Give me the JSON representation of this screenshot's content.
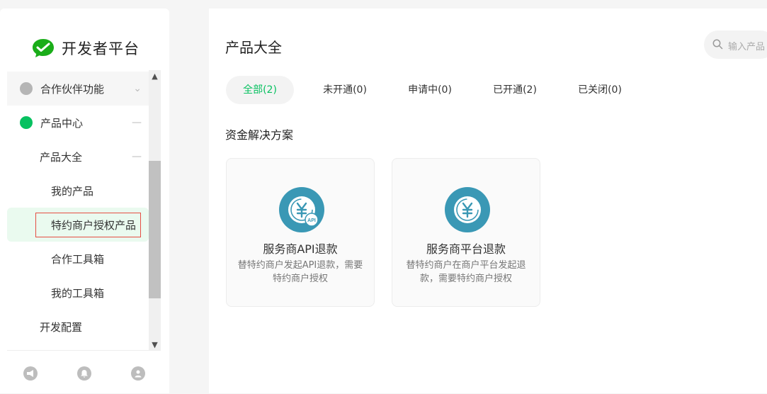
{
  "sidebar": {
    "logo": {
      "title": "开发者平台",
      "icon": "wechat-pay-icon",
      "color": "#1aad19"
    },
    "items": [
      {
        "label": "合作伙伴功能",
        "toggle": "⌄",
        "dot_color": "#b5b5b5"
      },
      {
        "label": "产品中心",
        "toggle": "—",
        "dot_color": "#07c160"
      },
      {
        "label": "产品大全",
        "toggle": "—"
      },
      {
        "label": "我的产品"
      },
      {
        "label": "特约商户授权产品"
      },
      {
        "label": "合作工具箱"
      },
      {
        "label": "我的工具箱"
      },
      {
        "label": "开发配置"
      }
    ],
    "footer_icons": [
      "megaphone-icon",
      "bell-icon",
      "user-icon"
    ]
  },
  "main": {
    "title": "产品大全",
    "search": {
      "placeholder": "输入产品"
    },
    "tabs": [
      {
        "label": "全部(2)"
      },
      {
        "label": "未开通(0)"
      },
      {
        "label": "申请中(0)"
      },
      {
        "label": "已开通(2)"
      },
      {
        "label": "已关闭(0)"
      }
    ],
    "section_title": "资金解决方案",
    "cards": [
      {
        "name": "服务商API退款",
        "desc": "替特约商户发起API退款，需要特约商户授权",
        "icon": "yuan-refund-api-icon",
        "badge": "API"
      },
      {
        "name": "服务商平台退款",
        "desc": "替特约商户在商户平台发起退款，需要特约商户授权",
        "icon": "yuan-refund-icon"
      }
    ]
  },
  "colors": {
    "accent": "#07c160",
    "icon_bg": "#3a98b5"
  }
}
